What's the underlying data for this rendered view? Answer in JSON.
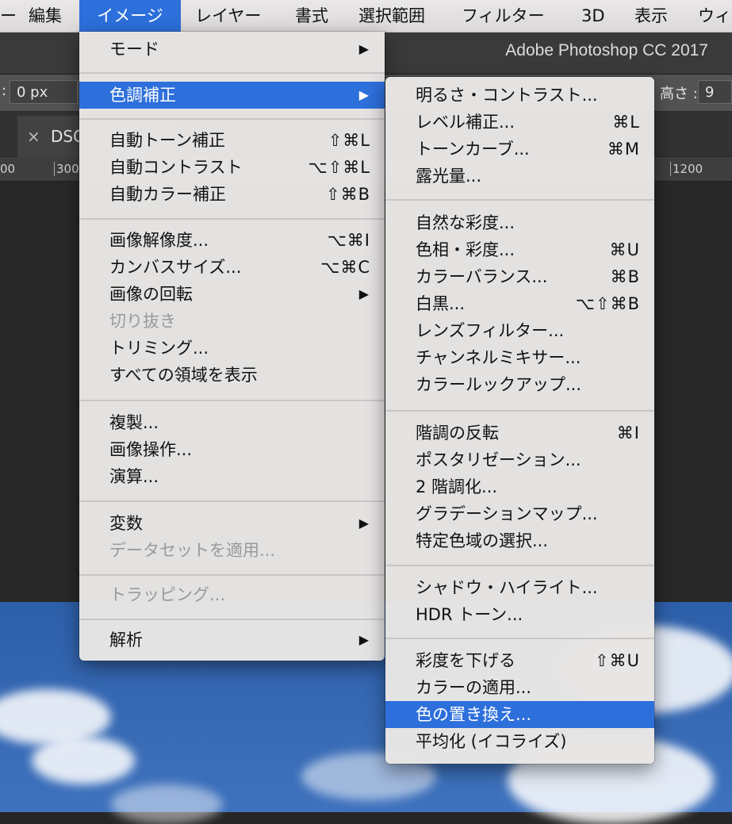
{
  "menubar": {
    "items": [
      {
        "label": "ー"
      },
      {
        "label": "編集"
      },
      {
        "label": "イメージ"
      },
      {
        "label": "レイヤー"
      },
      {
        "label": "書式"
      },
      {
        "label": "選択範囲"
      },
      {
        "label": "フィルター"
      },
      {
        "label": "3D"
      },
      {
        "label": "表示"
      },
      {
        "label": "ウィ"
      }
    ]
  },
  "app": {
    "title": "Adobe Photoshop CC 2017"
  },
  "options": {
    "left_prefix": ":",
    "left_value": "0 px",
    "height_label": "高さ :",
    "height_value": "9"
  },
  "document": {
    "tab_label": "DSC",
    "close": "×"
  },
  "ruler": {
    "marks": [
      "00",
      "300",
      "1200"
    ]
  },
  "image_menu": {
    "items": [
      {
        "label": "モード",
        "shortcut": "",
        "submenu": true,
        "disabled": false
      },
      {
        "label": "色調補正",
        "shortcut": "",
        "submenu": true,
        "disabled": false
      },
      {
        "label": "自動トーン補正",
        "shortcut": "⇧⌘L"
      },
      {
        "label": "自動コントラスト",
        "shortcut": "⌥⇧⌘L"
      },
      {
        "label": "自動カラー補正",
        "shortcut": "⇧⌘B"
      },
      {
        "label": "画像解像度...",
        "shortcut": "⌥⌘I"
      },
      {
        "label": "カンバスサイズ...",
        "shortcut": "⌥⌘C"
      },
      {
        "label": "画像の回転",
        "shortcut": "",
        "submenu": true
      },
      {
        "label": "切り抜き",
        "shortcut": "",
        "disabled": true
      },
      {
        "label": "トリミング...",
        "shortcut": ""
      },
      {
        "label": "すべての領域を表示",
        "shortcut": ""
      },
      {
        "label": "複製...",
        "shortcut": ""
      },
      {
        "label": "画像操作...",
        "shortcut": ""
      },
      {
        "label": "演算...",
        "shortcut": ""
      },
      {
        "label": "変数",
        "shortcut": "",
        "submenu": true
      },
      {
        "label": "データセットを適用...",
        "shortcut": "",
        "disabled": true
      },
      {
        "label": "トラッピング...",
        "shortcut": "",
        "disabled": true
      },
      {
        "label": "解析",
        "shortcut": "",
        "submenu": true
      }
    ],
    "arrow": "▶"
  },
  "adjust_menu": {
    "items": [
      {
        "label": "明るさ・コントラスト...",
        "shortcut": ""
      },
      {
        "label": "レベル補正...",
        "shortcut": "⌘L"
      },
      {
        "label": "トーンカーブ...",
        "shortcut": "⌘M"
      },
      {
        "label": "露光量...",
        "shortcut": ""
      },
      {
        "label": "自然な彩度...",
        "shortcut": ""
      },
      {
        "label": "色相・彩度...",
        "shortcut": "⌘U"
      },
      {
        "label": "カラーバランス...",
        "shortcut": "⌘B"
      },
      {
        "label": "白黒...",
        "shortcut": "⌥⇧⌘B"
      },
      {
        "label": "レンズフィルター...",
        "shortcut": ""
      },
      {
        "label": "チャンネルミキサー...",
        "shortcut": ""
      },
      {
        "label": "カラールックアップ...",
        "shortcut": ""
      },
      {
        "label": "階調の反転",
        "shortcut": "⌘I"
      },
      {
        "label": "ポスタリゼーション...",
        "shortcut": ""
      },
      {
        "label": "2 階調化...",
        "shortcut": ""
      },
      {
        "label": "グラデーションマップ...",
        "shortcut": ""
      },
      {
        "label": "特定色域の選択...",
        "shortcut": ""
      },
      {
        "label": "シャドウ・ハイライト...",
        "shortcut": ""
      },
      {
        "label": "HDR トーン...",
        "shortcut": ""
      },
      {
        "label": "彩度を下げる",
        "shortcut": "⇧⌘U"
      },
      {
        "label": "カラーの適用...",
        "shortcut": ""
      },
      {
        "label": "色の置き換え...",
        "shortcut": ""
      },
      {
        "label": "平均化 (イコライズ)",
        "shortcut": ""
      }
    ]
  },
  "colors": {
    "highlight": "#2d6fdb",
    "menu_bg": "#e8e6e5",
    "disabled_text": "#9a9a9a"
  }
}
